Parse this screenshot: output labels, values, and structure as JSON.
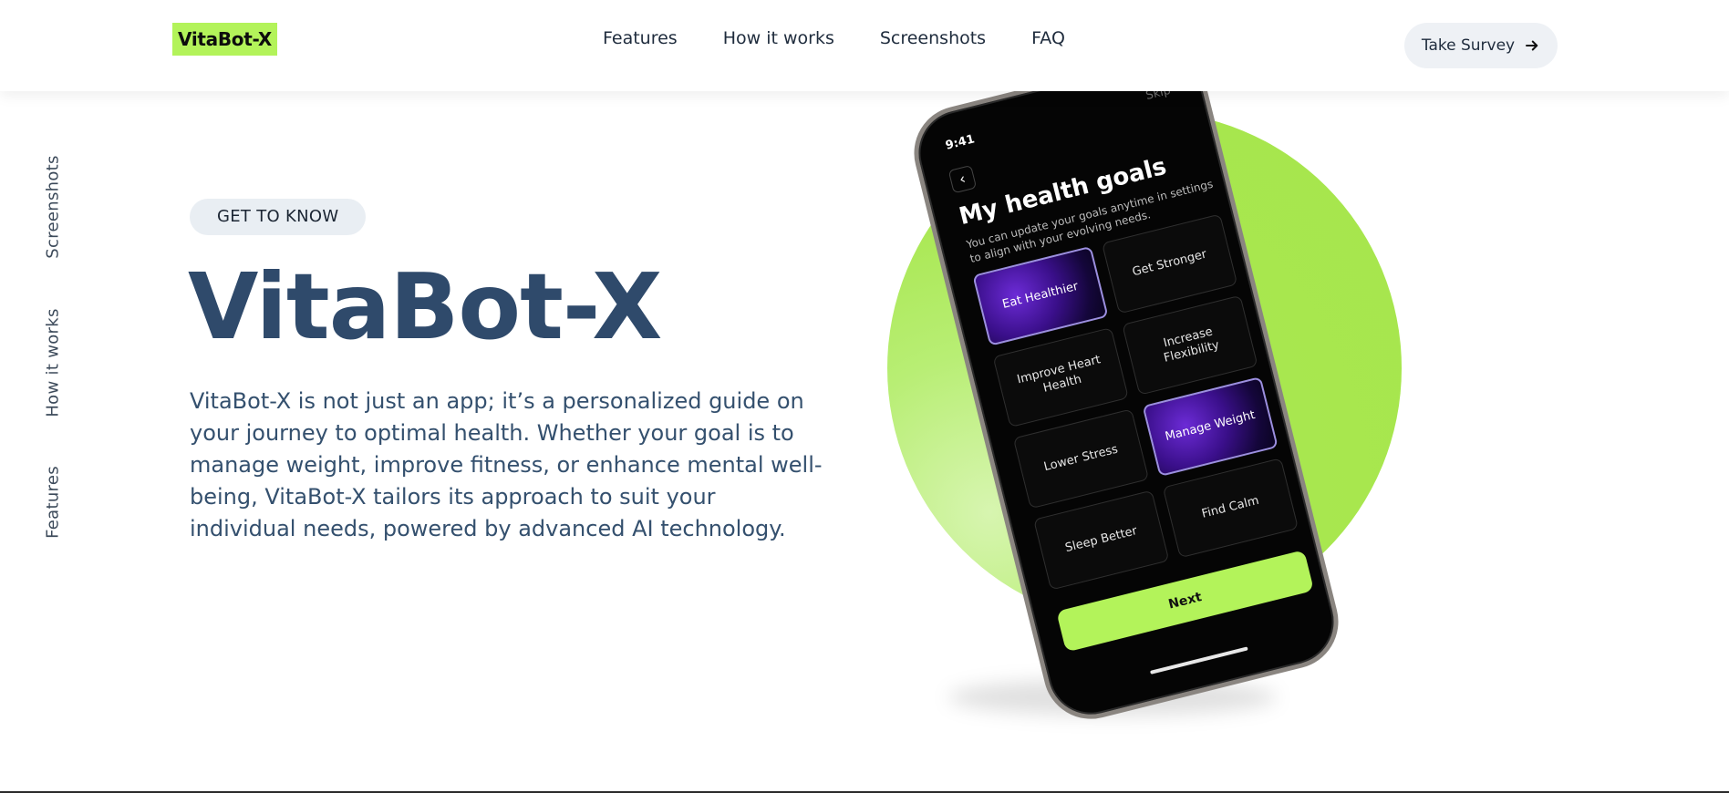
{
  "brand": {
    "logo": "VitaBot-X",
    "accent": "#b3f35a",
    "heading_color": "#2f4a6b"
  },
  "nav": {
    "items": [
      {
        "label": "Features"
      },
      {
        "label": "How it works"
      },
      {
        "label": "Screenshots"
      },
      {
        "label": "FAQ"
      }
    ],
    "cta_label": "Take Survey",
    "cta_icon": "arrow-right-icon"
  },
  "side_nav": {
    "items": [
      {
        "label": "Screenshots"
      },
      {
        "label": "How it works"
      },
      {
        "label": "Features"
      }
    ]
  },
  "hero": {
    "eyebrow": "GET TO KNOW",
    "title": "VitaBot-X",
    "description": "VitaBot-X is not just an app; it’s a personalized guide on your journey to optimal health. Whether your goal is to manage weight, improve fitness, or enhance mental well-being, VitaBot-X tailors its approach to suit your individual needs, powered by advanced AI technology."
  },
  "phone": {
    "time": "9:41",
    "skip": "Skip",
    "title": "My health goals",
    "subtitle": "You can update your goals anytime in settings to align with your evolving needs.",
    "goals": [
      {
        "label": "Eat Healthier",
        "selected": true
      },
      {
        "label": "Get Stronger",
        "selected": false
      },
      {
        "label": "Improve Heart Health",
        "selected": false
      },
      {
        "label": "Increase Flexibility",
        "selected": false
      },
      {
        "label": "Lower Stress",
        "selected": false
      },
      {
        "label": "Manage Weight",
        "selected": true
      },
      {
        "label": "Sleep Better",
        "selected": false
      },
      {
        "label": "Find Calm",
        "selected": false
      }
    ],
    "next_label": "Next"
  }
}
